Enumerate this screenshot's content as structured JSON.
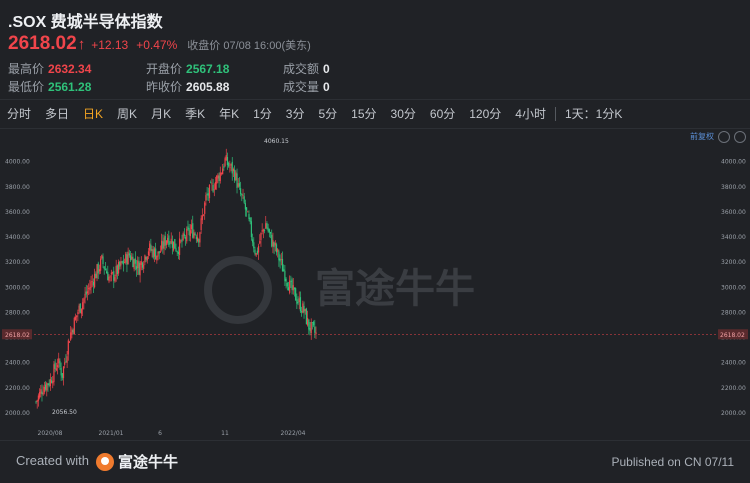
{
  "header": {
    "title": ".SOX 费城半导体指数",
    "price": "2618.02",
    "change": "+12.13",
    "change_pct": "+0.47%",
    "close_label": "收盘价 07/08 16:00(美东)",
    "stats": [
      {
        "label": "最高价",
        "value": "2632.34",
        "color": "#f0454b"
      },
      {
        "label": "最低价",
        "value": "2561.28",
        "color": "#2fc17a"
      },
      {
        "label": "开盘价",
        "value": "2567.18",
        "color": "#2fc17a"
      },
      {
        "label": "昨收价",
        "value": "2605.88",
        "color": "#e6e8eb"
      },
      {
        "label": "成交额",
        "value": "0",
        "color": "#e6e8eb"
      },
      {
        "label": "成交量",
        "value": "0",
        "color": "#e6e8eb"
      }
    ]
  },
  "tabs": [
    "分时",
    "多日",
    "日K",
    "周K",
    "月K",
    "季K",
    "年K",
    "1分",
    "3分",
    "5分",
    "15分",
    "30分",
    "60分",
    "120分",
    "4小时",
    "1天：1分K"
  ],
  "active_tab": "日K",
  "toolbar": {
    "adjust_label": "前复权"
  },
  "colors": {
    "up": "#f0454b",
    "down": "#2fc17a",
    "accent": "#f5a623",
    "link": "#5b8fd6"
  },
  "chart_data": {
    "type": "candlestick",
    "y_ticks": [
      "4000.00",
      "3800.00",
      "3600.00",
      "3400.00",
      "3200.00",
      "3000.00",
      "2800.00",
      "2600.00",
      "2400.00",
      "2200.00",
      "2000.00"
    ],
    "ylim": [
      1920,
      4180
    ],
    "x_ticks": [
      "2020/08",
      "2021/01",
      "6",
      "11",
      "2022/04"
    ],
    "last_price": 2618.02,
    "last_price_label": "2618.02",
    "max_label": "4060.15",
    "min_label": "2056.50",
    "trend": [
      [
        0,
        2080
      ],
      [
        6,
        2200
      ],
      [
        12,
        2250
      ],
      [
        18,
        2400
      ],
      [
        22,
        2300
      ],
      [
        28,
        2600
      ],
      [
        35,
        2800
      ],
      [
        45,
        3000
      ],
      [
        55,
        3200
      ],
      [
        62,
        3050
      ],
      [
        70,
        3150
      ],
      [
        78,
        3250
      ],
      [
        86,
        3150
      ],
      [
        94,
        3300
      ],
      [
        102,
        3250
      ],
      [
        110,
        3400
      ],
      [
        118,
        3300
      ],
      [
        124,
        3380
      ],
      [
        130,
        3450
      ],
      [
        136,
        3400
      ],
      [
        142,
        3700
      ],
      [
        148,
        3800
      ],
      [
        154,
        3900
      ],
      [
        158,
        4000
      ],
      [
        162,
        3950
      ],
      [
        166,
        3900
      ],
      [
        170,
        3750
      ],
      [
        174,
        3650
      ],
      [
        178,
        3500
      ],
      [
        184,
        3250
      ],
      [
        188,
        3400
      ],
      [
        192,
        3500
      ],
      [
        196,
        3380
      ],
      [
        200,
        3300
      ],
      [
        206,
        3150
      ],
      [
        212,
        3000
      ],
      [
        218,
        2900
      ],
      [
        224,
        2800
      ],
      [
        228,
        2680
      ],
      [
        232,
        2640
      ],
      [
        234,
        2618
      ]
    ]
  },
  "watermark": "富途牛牛",
  "footer": {
    "created_label": "Created with",
    "brand": "富途牛牛",
    "published": "Published on CN 07/11"
  }
}
